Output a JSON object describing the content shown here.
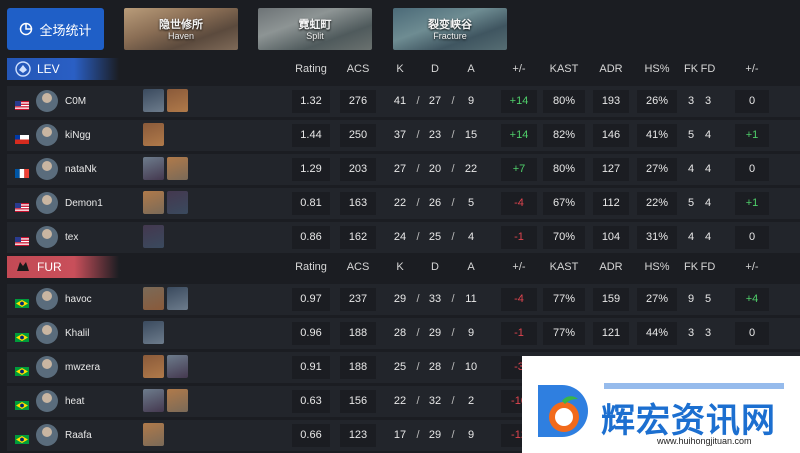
{
  "overall": {
    "label": "全场统计"
  },
  "maps": [
    {
      "cn": "隐世修所",
      "en": "Haven"
    },
    {
      "cn": "霓虹町",
      "en": "Split"
    },
    {
      "cn": "裂变峡谷",
      "en": "Fracture"
    }
  ],
  "columns": [
    "Rating",
    "ACS",
    "K",
    "D",
    "A",
    "+/-",
    "KAST",
    "ADR",
    "HS%",
    "FK",
    "FD",
    "+/-"
  ],
  "teams": [
    {
      "name": "LEV",
      "color": "#2456b6",
      "players": [
        {
          "name": "C0M",
          "flag": "us",
          "rating": "1.32",
          "acs": "276",
          "k": "41",
          "d": "27",
          "a": "9",
          "pm": "+14",
          "kast": "80%",
          "adr": "193",
          "hs": "26%",
          "fk": "3",
          "fd": "3",
          "fpm": "0"
        },
        {
          "name": "kiNgg",
          "flag": "cl",
          "rating": "1.44",
          "acs": "250",
          "k": "37",
          "d": "23",
          "a": "15",
          "pm": "+14",
          "kast": "82%",
          "adr": "146",
          "hs": "41%",
          "fk": "5",
          "fd": "4",
          "fpm": "+1"
        },
        {
          "name": "nataNk",
          "flag": "fr",
          "rating": "1.29",
          "acs": "203",
          "k": "27",
          "d": "20",
          "a": "22",
          "pm": "+7",
          "kast": "80%",
          "adr": "127",
          "hs": "27%",
          "fk": "4",
          "fd": "4",
          "fpm": "0"
        },
        {
          "name": "Demon1",
          "flag": "us",
          "rating": "0.81",
          "acs": "163",
          "k": "22",
          "d": "26",
          "a": "5",
          "pm": "-4",
          "kast": "67%",
          "adr": "112",
          "hs": "22%",
          "fk": "5",
          "fd": "4",
          "fpm": "+1"
        },
        {
          "name": "tex",
          "flag": "us",
          "rating": "0.86",
          "acs": "162",
          "k": "24",
          "d": "25",
          "a": "4",
          "pm": "-1",
          "kast": "70%",
          "adr": "104",
          "hs": "31%",
          "fk": "4",
          "fd": "4",
          "fpm": "0"
        }
      ]
    },
    {
      "name": "FUR",
      "color": "#c34a55",
      "players": [
        {
          "name": "havoc",
          "flag": "br",
          "rating": "0.97",
          "acs": "237",
          "k": "29",
          "d": "33",
          "a": "11",
          "pm": "-4",
          "kast": "77%",
          "adr": "159",
          "hs": "27%",
          "fk": "9",
          "fd": "5",
          "fpm": "+4"
        },
        {
          "name": "Khalil",
          "flag": "br",
          "rating": "0.96",
          "acs": "188",
          "k": "28",
          "d": "29",
          "a": "9",
          "pm": "-1",
          "kast": "77%",
          "adr": "121",
          "hs": "44%",
          "fk": "3",
          "fd": "3",
          "fpm": "0"
        },
        {
          "name": "mwzera",
          "flag": "br",
          "rating": "0.91",
          "acs": "188",
          "k": "25",
          "d": "28",
          "a": "10",
          "pm": "-3",
          "kast": "",
          "adr": "",
          "hs": "",
          "fk": "",
          "fd": "",
          "fpm": ""
        },
        {
          "name": "heat",
          "flag": "br",
          "rating": "0.63",
          "acs": "156",
          "k": "22",
          "d": "32",
          "a": "2",
          "pm": "-10",
          "kast": "",
          "adr": "",
          "hs": "",
          "fk": "",
          "fd": "",
          "fpm": ""
        },
        {
          "name": "Raafa",
          "flag": "br",
          "rating": "0.66",
          "acs": "123",
          "k": "17",
          "d": "29",
          "a": "9",
          "pm": "-12",
          "kast": "",
          "adr": "",
          "hs": "",
          "fk": "",
          "fd": "",
          "fpm": ""
        }
      ]
    }
  ],
  "watermark": {
    "text": "辉宏资讯网",
    "url": "www.huihongjituan.com"
  }
}
